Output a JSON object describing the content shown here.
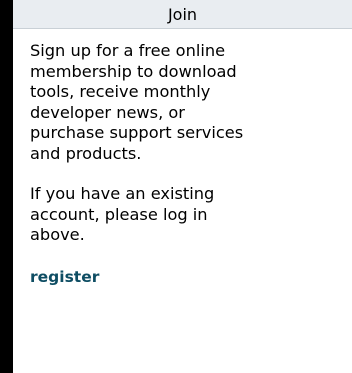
{
  "panel": {
    "title": "Join",
    "intro_text": "Sign up for a free online\nmembership to download\ntools, receive monthly\ndeveloper news, or\npurchase support services\nand products.",
    "login_text": "If you have an existing\naccount, please log in\nabove.",
    "register_label": "register"
  },
  "colors": {
    "background": "#000000",
    "panel": "#ffffff",
    "header": "#e9edf1",
    "link": "#0e4d63"
  }
}
